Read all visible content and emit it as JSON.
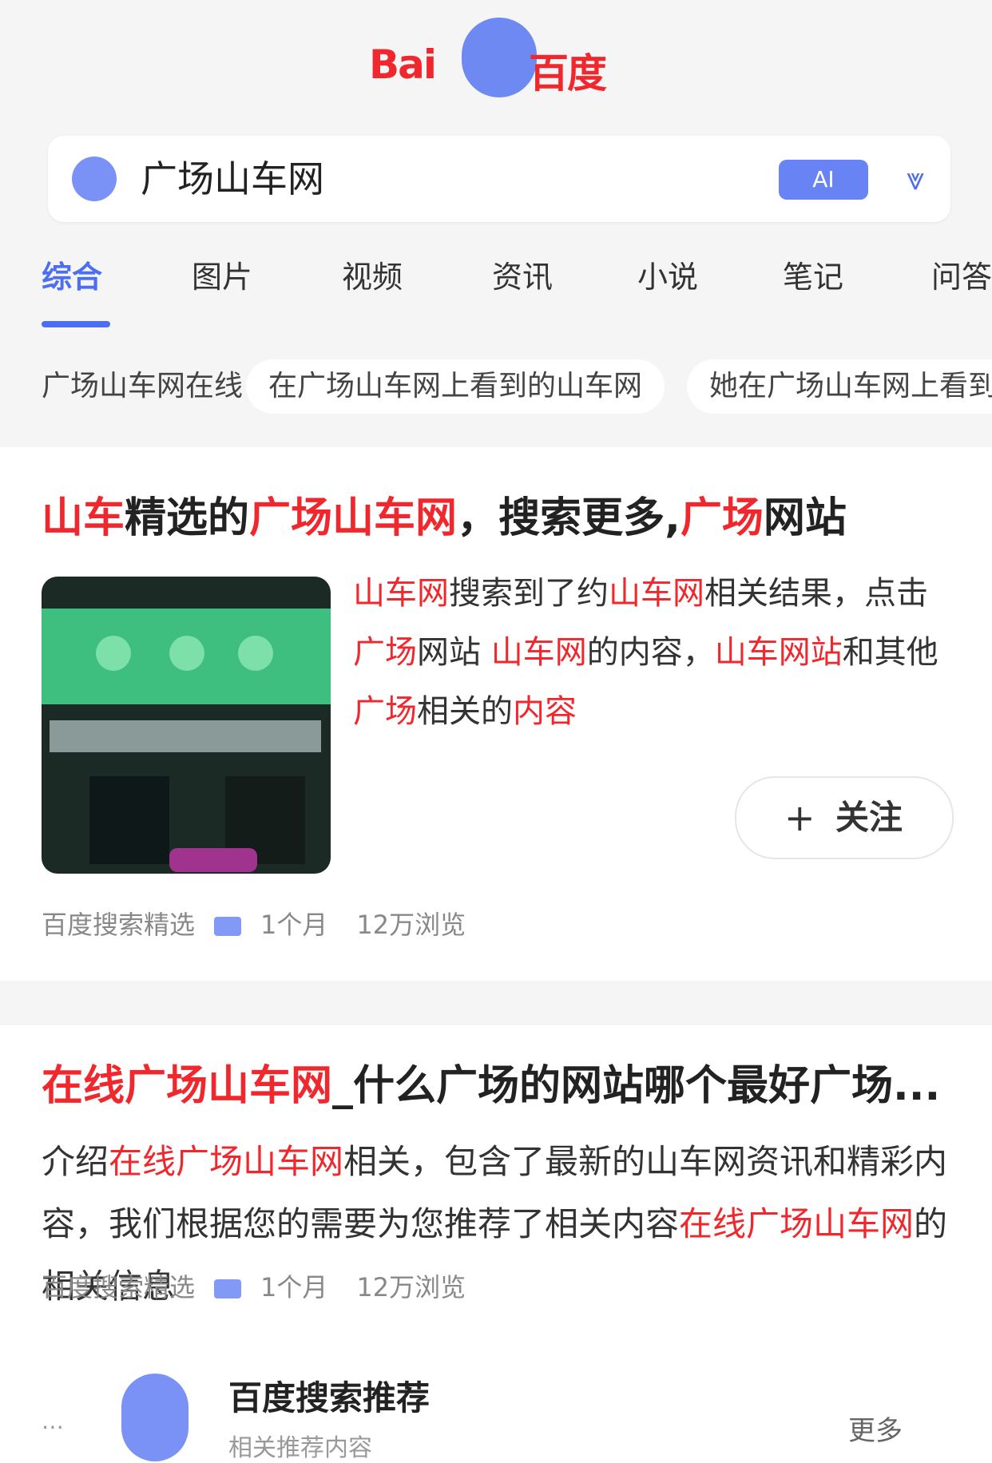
{
  "logo": {
    "left_text": "Bai",
    "right_text": "百度"
  },
  "search": {
    "query": "广场山车网",
    "ai_button": "AI",
    "filter_icon": "filter-icon"
  },
  "tabs": [
    "综合",
    "图片",
    "视频",
    "资讯",
    "小说",
    "笔记",
    "问答"
  ],
  "active_tab": "综合",
  "chips": [
    "广场山车网在线",
    "在广场山车网上看到的山车网",
    "她在广场山车网上看到"
  ],
  "result1": {
    "title_hl1": "山车",
    "title_mid1": "精选的",
    "title_hl2": "广场",
    "title_mid2": "",
    "title_hl3": "山车网",
    "title_mid3": "，搜索更多,",
    "title_hl4": "广场",
    "title_tail": "网站",
    "snippet_hl1": "山车网",
    "snippet_mid1": "搜索到了约",
    "snippet_hl2": "山车网",
    "snippet_mid2": "相关结果，点击",
    "snippet_hl3": "广场",
    "snippet_mid3": "网站 ",
    "snippet_hl4": "山车网",
    "snippet_mid4": "的内容，",
    "snippet_hl5": "山车网站",
    "snippet_mid5": "和其他",
    "snippet_hl6": "广场",
    "snippet_mid6": "相关的",
    "snippet_hl7": "内容",
    "follow_label": "关注",
    "source_name": "百度搜索精选",
    "source_tag": "V",
    "source_time": "1个月",
    "source_extra": "12万浏览"
  },
  "result2": {
    "title_hl": "在线广场山车网",
    "title_tail": "_什么广场的网站哪个最好广场...",
    "snippet_pre": "介绍",
    "snippet_hl1": "在线广场山车网",
    "snippet_mid1": "相关，包含了最新的山车网资讯和精彩内容，我们根据",
    "snippet_mid2": "您的需要为您推荐了相关内容",
    "snippet_hl2": "在线广场山车网",
    "snippet_tail": "的相关信息",
    "source_name": "百度搜索精选",
    "source_tag": "V",
    "source_time": "1个月",
    "source_extra": "12万浏览"
  },
  "author": {
    "name": "百度搜索推荐",
    "sub": "相关推荐内容",
    "more": "更多"
  }
}
